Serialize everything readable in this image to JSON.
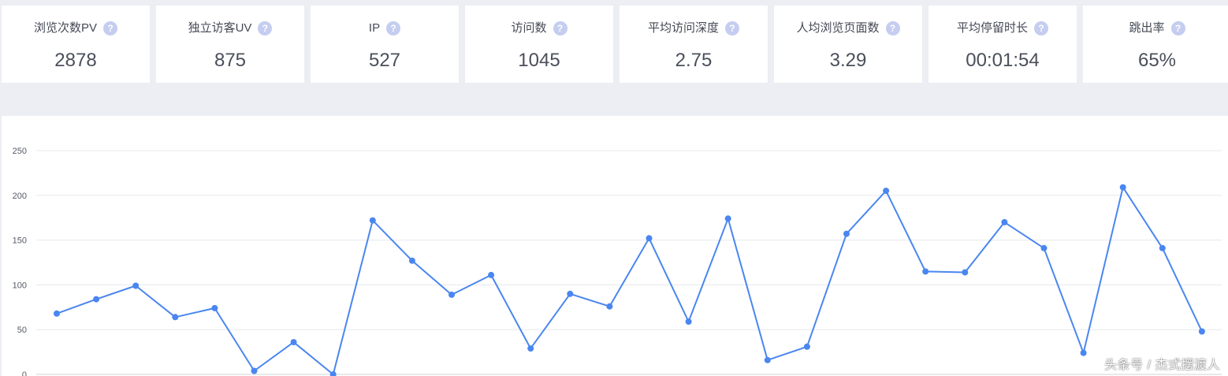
{
  "stats": [
    {
      "label": "浏览次数PV",
      "value": "2878"
    },
    {
      "label": "独立访客UV",
      "value": "875"
    },
    {
      "label": "IP",
      "value": "527"
    },
    {
      "label": "访问数",
      "value": "1045"
    },
    {
      "label": "平均访问深度",
      "value": "2.75"
    },
    {
      "label": "人均浏览页面数",
      "value": "3.29"
    },
    {
      "label": "平均停留时长",
      "value": "00:01:54"
    },
    {
      "label": "跳出率",
      "value": "65%"
    }
  ],
  "help_icon_glyph": "?",
  "watermark": "头条号 / 杰式摆渡人",
  "colors": {
    "line": "#4a86f0",
    "grid": "#e6e8ec",
    "help_icon": "#c5cdf0"
  },
  "chart_data": {
    "type": "line",
    "title": "",
    "xlabel": "",
    "ylabel": "",
    "ylim": [
      0,
      250
    ],
    "yticks": [
      "0",
      "50",
      "100",
      "150",
      "200",
      "250"
    ],
    "grid": true,
    "series": [
      {
        "values": [
          68,
          84,
          99,
          64,
          74,
          4,
          36,
          0,
          172,
          127,
          89,
          111,
          29,
          90,
          76,
          152,
          59,
          174,
          16,
          31,
          157,
          205,
          115,
          114,
          170,
          141,
          24,
          209,
          141,
          48
        ]
      }
    ]
  }
}
